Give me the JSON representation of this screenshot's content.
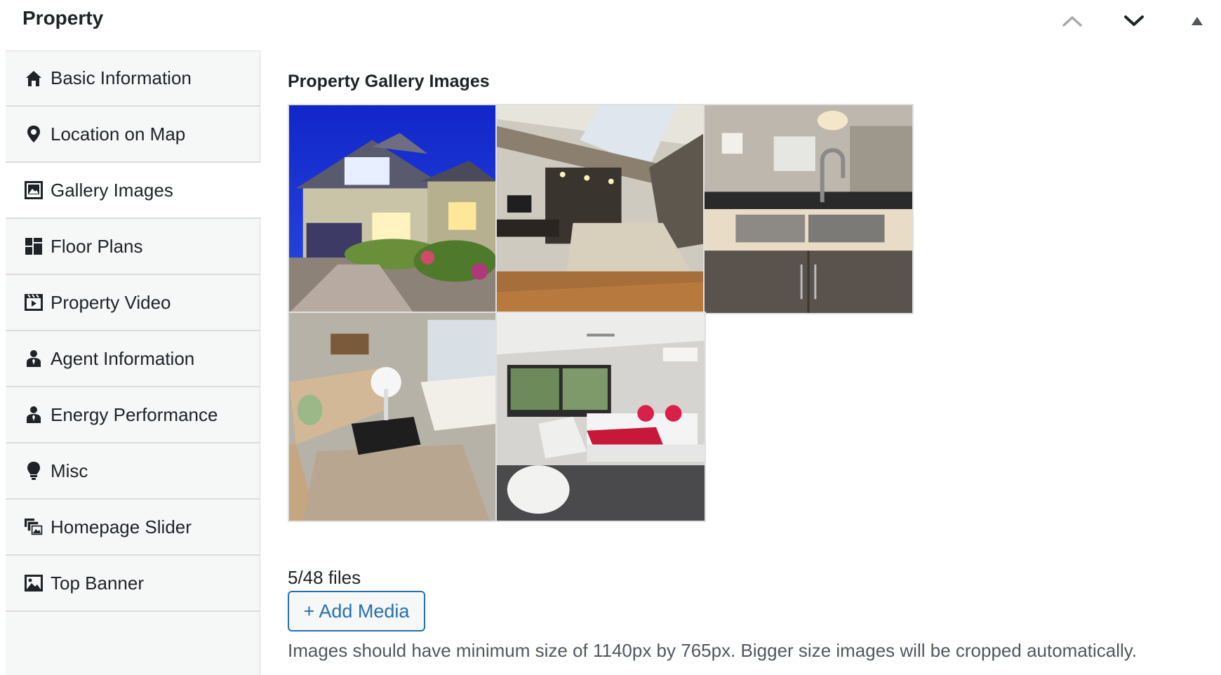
{
  "metabox": {
    "title": "Property",
    "controls": {
      "move_up_icon": "chevron-up-icon",
      "move_down_icon": "chevron-down-icon",
      "toggle_icon": "triangle-up-icon"
    }
  },
  "sidebar": {
    "items": [
      {
        "label": "Basic Information",
        "icon": "home-icon",
        "active": false
      },
      {
        "label": "Location on Map",
        "icon": "location-pin-icon",
        "active": false
      },
      {
        "label": "Gallery Images",
        "icon": "gallery-icon",
        "active": true
      },
      {
        "label": "Floor Plans",
        "icon": "floor-plan-icon",
        "active": false
      },
      {
        "label": "Property Video",
        "icon": "video-icon",
        "active": false
      },
      {
        "label": "Agent Information",
        "icon": "agent-icon",
        "active": false
      },
      {
        "label": "Energy Performance",
        "icon": "agent-icon",
        "active": false
      },
      {
        "label": "Misc",
        "icon": "lightbulb-icon",
        "active": false
      },
      {
        "label": "Homepage Slider",
        "icon": "slides-icon",
        "active": false
      },
      {
        "label": "Top Banner",
        "icon": "image-icon",
        "active": false
      }
    ]
  },
  "main": {
    "section_title": "Property Gallery Images",
    "gallery": [
      {
        "subject": "house exterior at dusk"
      },
      {
        "subject": "bedroom with skylight"
      },
      {
        "subject": "kitchen sink"
      },
      {
        "subject": "living room with sofa"
      },
      {
        "subject": "bedroom with red bedding"
      }
    ],
    "file_count": "5/48 files",
    "add_media_label": "+ Add Media",
    "hint": "Images should have minimum size of 1140px by 765px. Bigger size images will be cropped automatically."
  },
  "colors": {
    "accent": "#2271b1",
    "text": "#1d2327",
    "muted_text": "#50575e",
    "sidebar_bg": "#f6f7f7",
    "border": "#dcdcde"
  }
}
